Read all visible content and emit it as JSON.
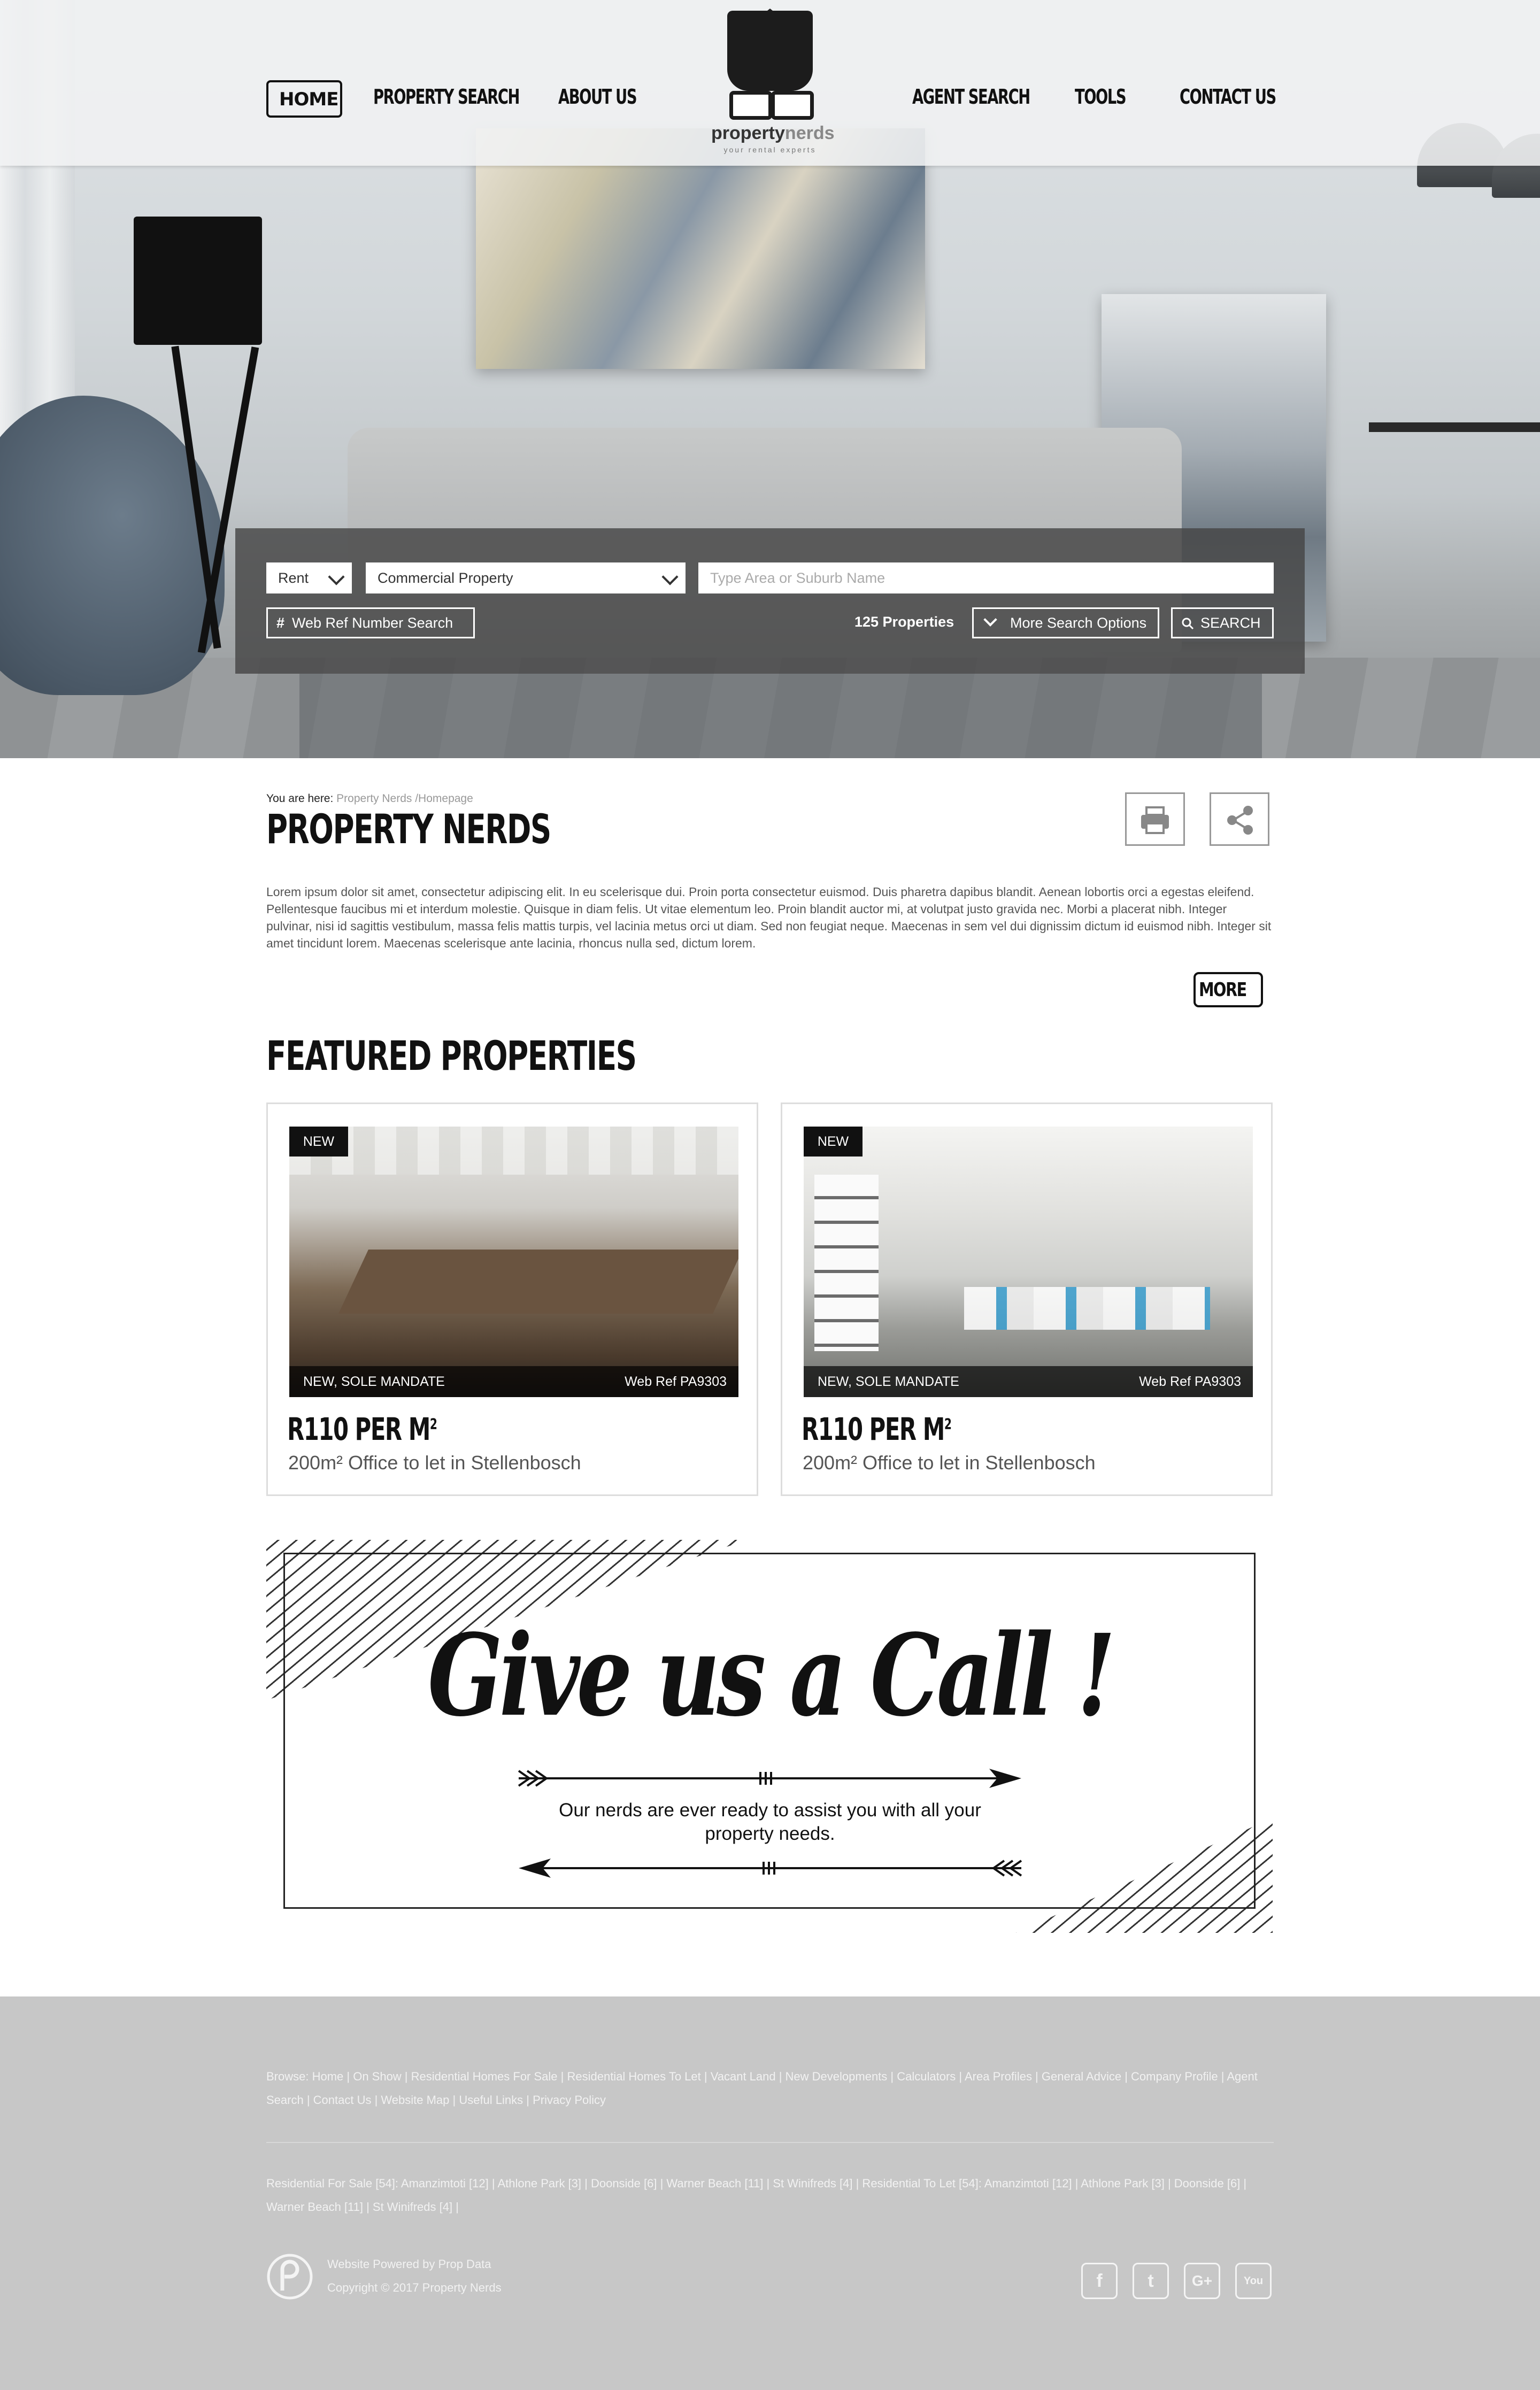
{
  "nav": {
    "items": [
      "HOME",
      "PROPERTY SEARCH",
      "ABOUT US",
      "AGENT SEARCH",
      "TOOLS",
      "CONTACT US"
    ],
    "logo_text_a": "property",
    "logo_text_b": "nerds",
    "logo_tagline": "your rental experts"
  },
  "search": {
    "type": "Rent",
    "category": "Commercial Property",
    "area_placeholder": "Type Area or Suburb Name",
    "ref_label": "Web Ref Number Search",
    "count": "125 Properties",
    "more_options": "More Search Options",
    "search_button": "SEARCH"
  },
  "content": {
    "breadcrumb_label": "You are here:",
    "breadcrumb_path": "Property Nerds /Homepage",
    "title": "PROPERTY NERDS",
    "body": "Lorem ipsum dolor sit amet, consectetur adipiscing elit. In eu scelerisque dui. Proin porta consectetur euismod. Duis pharetra dapibus blandit. Aenean lobortis orci a egestas eleifend. Pellentesque faucibus mi et interdum molestie. Quisque in diam felis. Ut vitae elementum leo. Proin blandit auctor mi, at volutpat justo gravida nec. Morbi a placerat nibh. Integer pulvinar, nisi id sagittis vestibulum, massa felis mattis turpis, vel lacinia metus orci ut diam. Sed non feugiat neque. Maecenas in sem vel dui dignissim dictum id euismod nibh. Integer sit amet tincidunt lorem. Maecenas scelerisque ante lacinia, rhoncus nulla sed, dictum lorem.",
    "more_button": "MORE",
    "featured_title": "FEATURED PROPERTIES"
  },
  "featured": [
    {
      "badge": "NEW",
      "status": "NEW, SOLE MANDATE",
      "ref": "Web Ref PA9303",
      "price": "R110 PER M",
      "price_unit": "2",
      "desc": "200m² Office to let in Stellenbosch"
    },
    {
      "badge": "NEW",
      "status": "NEW, SOLE MANDATE",
      "ref": "Web Ref PA9303",
      "price": "R110 PER M",
      "price_unit": "2",
      "desc": "200m² Office to let in Stellenbosch"
    }
  ],
  "call": {
    "title": "Give us a Call !",
    "subtitle": "Our nerds are ever ready to assist you with all your property needs."
  },
  "footer": {
    "browse": "Browse: Home | On Show | Residential Homes For Sale | Residential Homes To Let | Vacant Land | New Developments | Calculators | Area Profiles | General Advice | Company Profile | Agent Search | Contact Us | Website Map | Useful Links | Privacy Policy",
    "areas": "Residential For Sale [54]: Amanzimtoti [12] | Athlone Park [3] | Doonside [6] | Warner Beach [11] | St Winifreds [4] | Residential To Let [54]: Amanzimtoti [12] | Athlone Park [3] | Doonside [6] | Warner Beach [11] | St Winifreds [4] |",
    "powered": "Website Powered by Prop Data",
    "copyright": "Copyright © 2017 Property Nerds",
    "social": [
      "f",
      "t",
      "G+",
      "You"
    ]
  },
  "icons": [
    "print-icon",
    "share-icon",
    "hash-icon",
    "search-icon",
    "chevron-down-icon",
    "facebook-icon",
    "twitter-icon",
    "google-plus-icon",
    "youtube-icon",
    "propdata-logo-icon"
  ]
}
